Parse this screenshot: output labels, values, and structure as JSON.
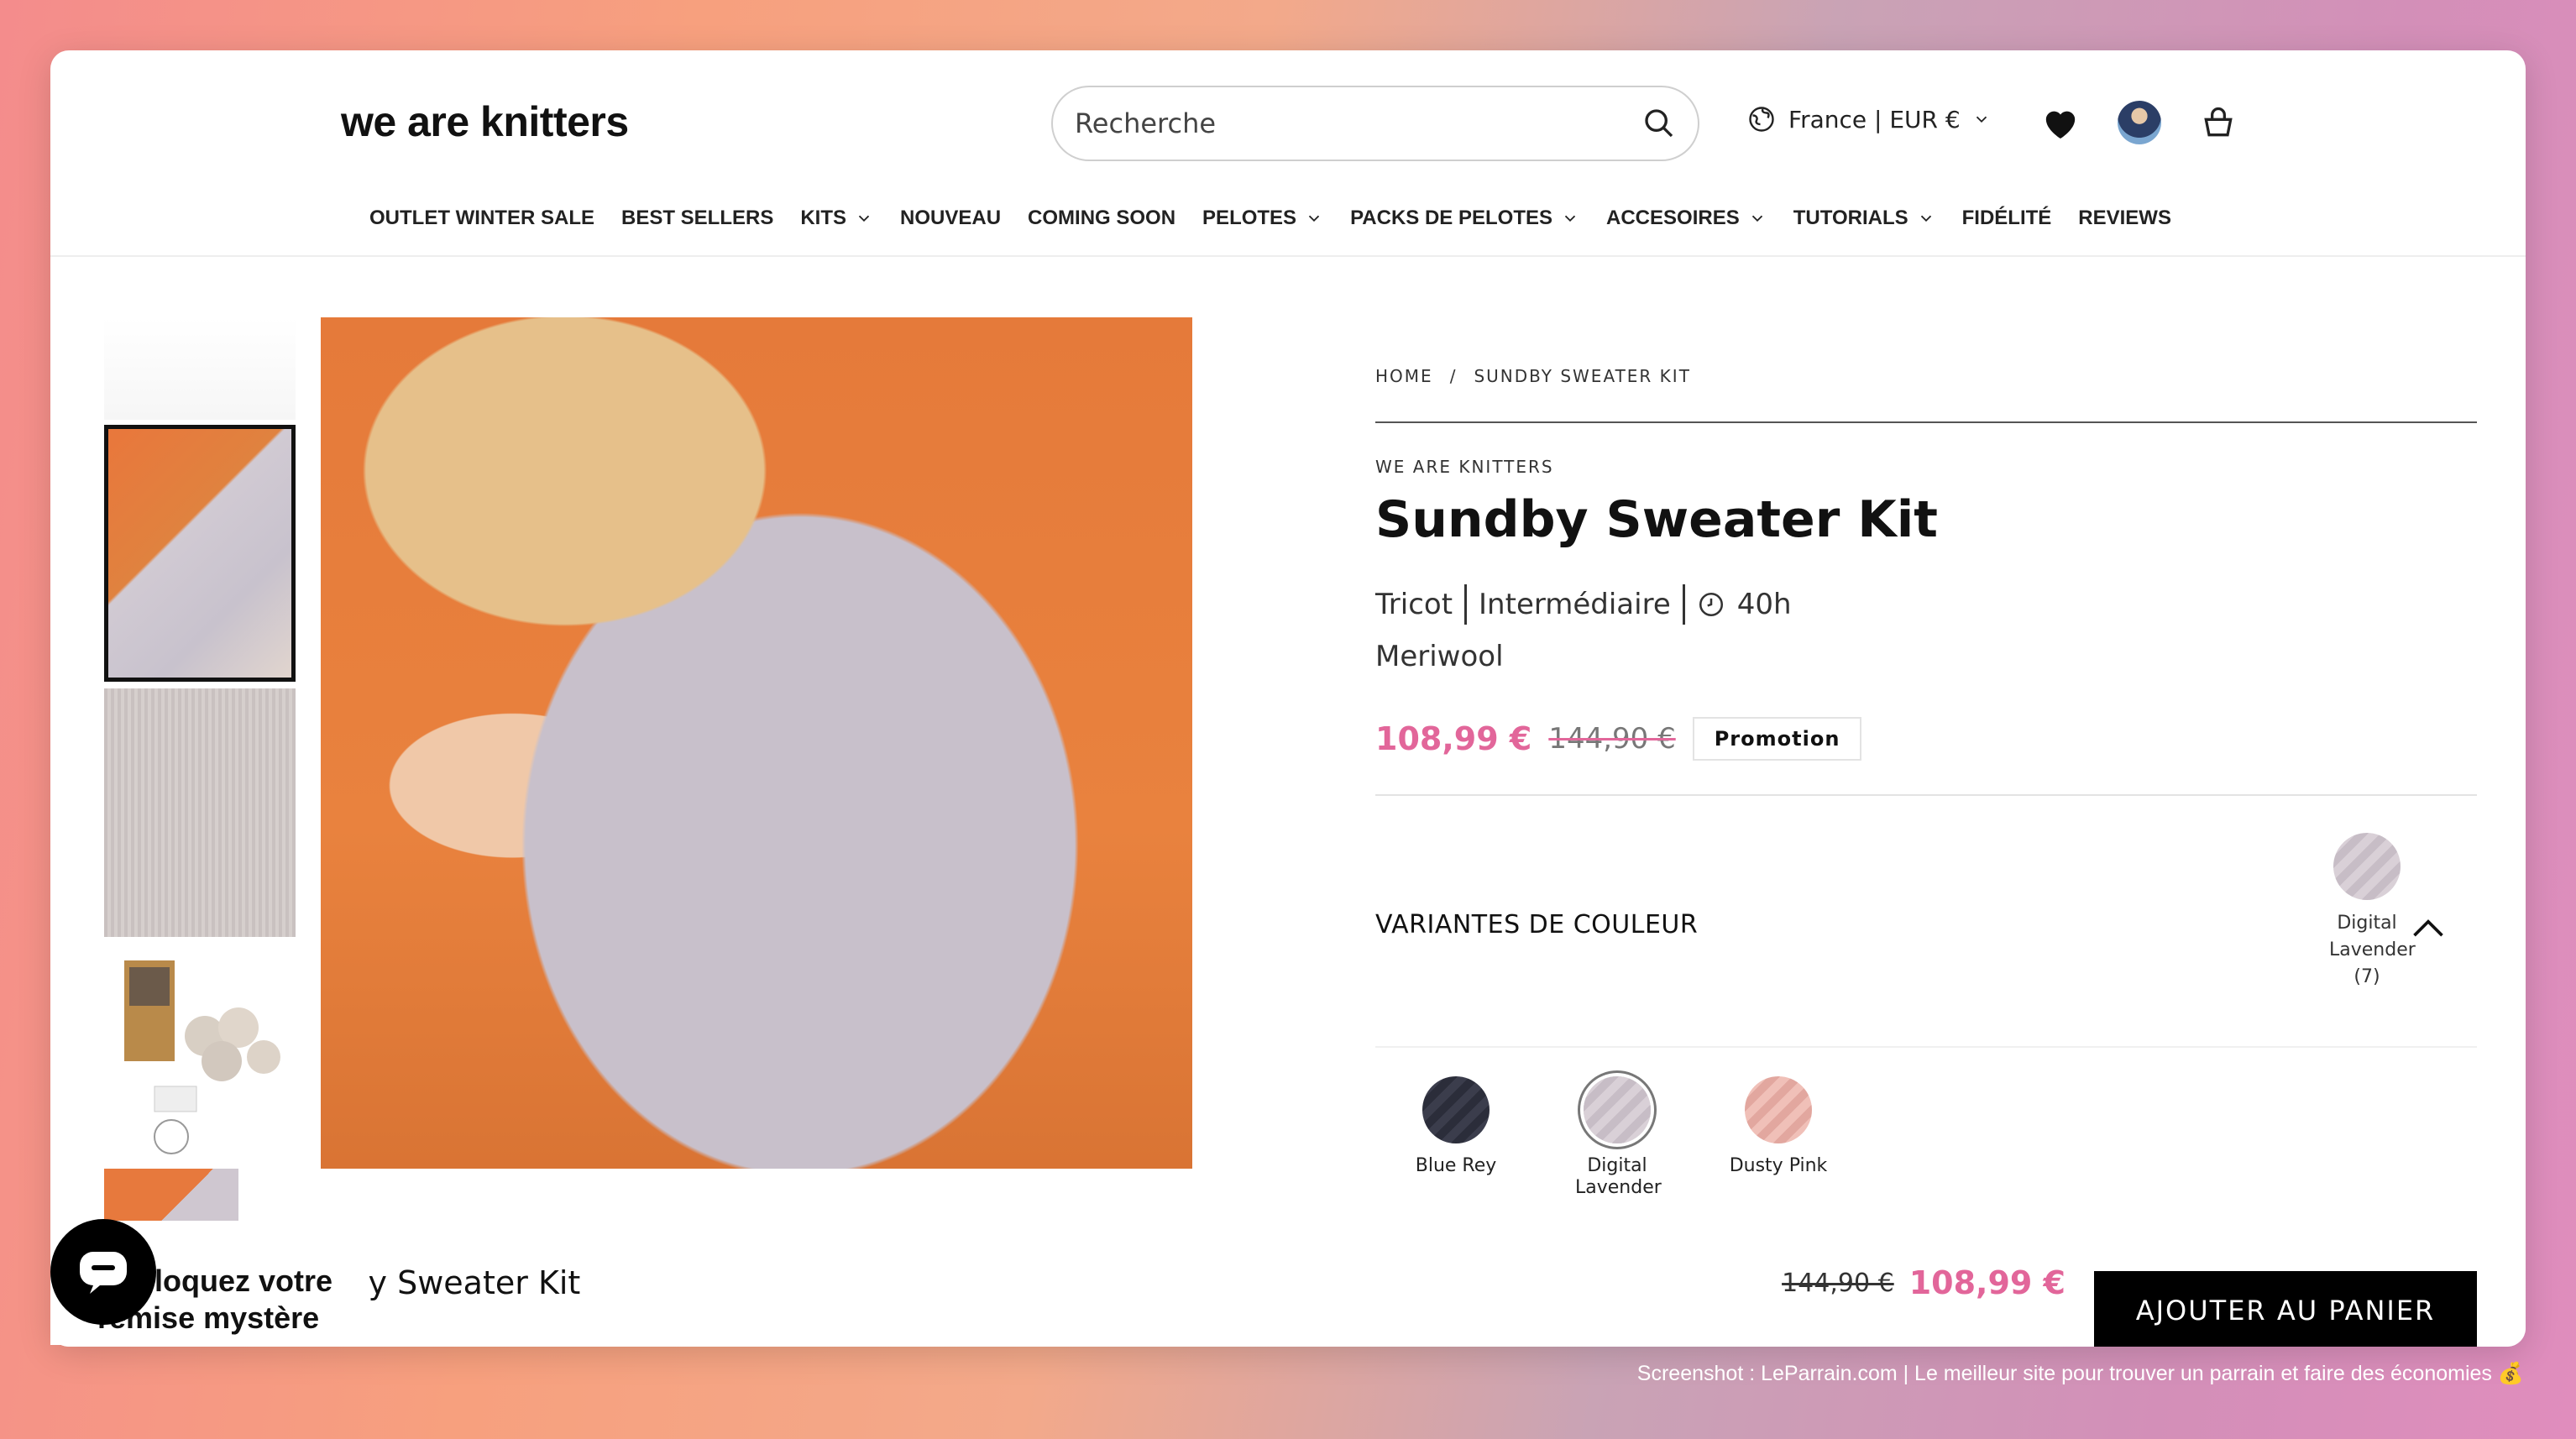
{
  "header": {
    "logo": "we are knitters",
    "search_placeholder": "Recherche",
    "locale": "France | EUR €"
  },
  "nav": {
    "items": [
      {
        "label": "OUTLET WINTER SALE",
        "dropdown": false
      },
      {
        "label": "BEST SELLERS",
        "dropdown": false
      },
      {
        "label": "KITS",
        "dropdown": true
      },
      {
        "label": "NOUVEAU",
        "dropdown": false
      },
      {
        "label": "COMING SOON",
        "dropdown": false
      },
      {
        "label": "PELOTES",
        "dropdown": true
      },
      {
        "label": "PACKS DE PELOTES",
        "dropdown": true
      },
      {
        "label": "ACCESOIRES",
        "dropdown": true
      },
      {
        "label": "TUTORIALS",
        "dropdown": true
      },
      {
        "label": "FIDÉLITÉ",
        "dropdown": false
      },
      {
        "label": "REVIEWS",
        "dropdown": false
      }
    ]
  },
  "breadcrumb": {
    "home": "HOME",
    "separator": "/",
    "current": "SUNDBY SWEATER KIT"
  },
  "product": {
    "brand": "WE ARE KNITTERS",
    "title": "Sundby Sweater Kit",
    "technique": "Tricot",
    "level": "Intermédiaire",
    "duration": "40h",
    "material": "Meriwool",
    "price_new": "108,99 €",
    "price_old": "144,90 €",
    "badge": "Promotion"
  },
  "variants": {
    "label": "VARIANTES DE COULEUR",
    "selected_name": "Digital Lavender",
    "selected_count": "(7)",
    "options": [
      {
        "name": "Blue Rey",
        "color": "#2f3140"
      },
      {
        "name": "Digital Lavender",
        "color": "#cfc5ce"
      },
      {
        "name": "Dusty Pink",
        "color": "#e9b3ab"
      }
    ]
  },
  "sticky": {
    "title": "Sundby Sweater Kit",
    "price_old": "144,90 €",
    "price_new": "108,99 €",
    "button": "AJOUTER AU PANIER"
  },
  "promo_widget": {
    "line1": "Débloquez votre",
    "line2": "remise mystère"
  },
  "footer_credit": "Screenshot : LeParrain.com | Le meilleur site pour trouver un parrain et faire des économies 💰",
  "colors": {
    "accent_pink": "#e2669a",
    "button_black": "#000000"
  }
}
